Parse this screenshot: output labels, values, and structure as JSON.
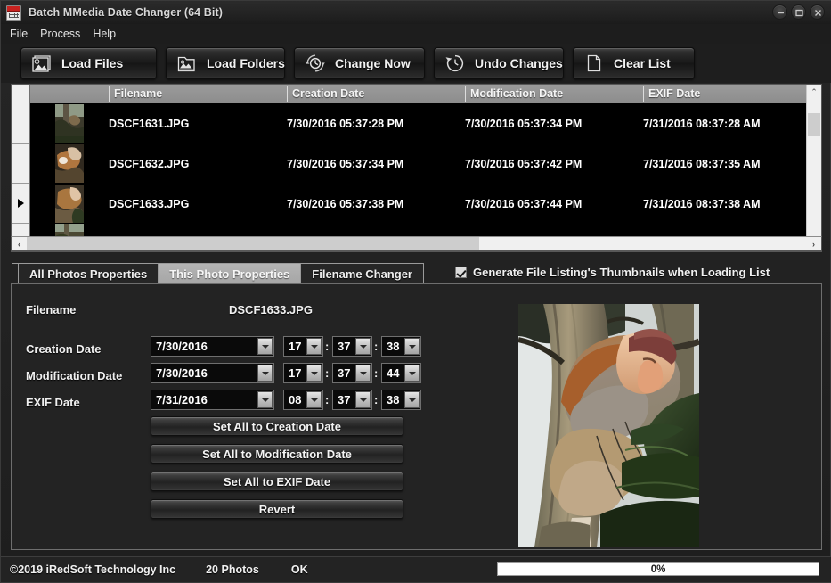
{
  "window": {
    "title": "Batch MMedia Date Changer (64 Bit)",
    "icon": "calendar-icon",
    "controls": [
      {
        "name": "minimize-button",
        "glyph": "minimize-icon"
      },
      {
        "name": "maximize-button",
        "glyph": "maximize-icon"
      },
      {
        "name": "close-button",
        "glyph": "close-icon"
      }
    ]
  },
  "menubar": {
    "items": [
      {
        "label": "File"
      },
      {
        "label": "Process"
      },
      {
        "label": "Help"
      }
    ]
  },
  "toolbar": {
    "buttons": [
      {
        "label": "Load Files",
        "icon": "picture-gear-icon"
      },
      {
        "label": "Load Folders",
        "icon": "folder-picture-icon"
      },
      {
        "label": "Change Now",
        "icon": "clock-refresh-icon"
      },
      {
        "label": "Undo Changes",
        "icon": "clock-undo-icon"
      },
      {
        "label": "Clear List",
        "icon": "page-icon"
      }
    ]
  },
  "filelist": {
    "columns": [
      "",
      "Filename",
      "Creation Date",
      "Modification Date",
      "EXIF Date"
    ],
    "rows": [
      {
        "filename": "DSCF1631.JPG",
        "creation": "7/30/2016 05:37:28 PM",
        "modification": "7/30/2016 05:37:34 PM",
        "exif": "7/31/2016 08:37:28 AM",
        "selected": false
      },
      {
        "filename": "DSCF1632.JPG",
        "creation": "7/30/2016 05:37:34 PM",
        "modification": "7/30/2016 05:37:42 PM",
        "exif": "7/31/2016 08:37:35 AM",
        "selected": false
      },
      {
        "filename": "DSCF1633.JPG",
        "creation": "7/30/2016 05:37:38 PM",
        "modification": "7/30/2016 05:37:44 PM",
        "exif": "7/31/2016 08:37:38 AM",
        "selected": true
      }
    ],
    "scroll": {
      "up_glyph": "⌃",
      "down_glyph": "⌄",
      "left_glyph": "‹",
      "right_glyph": "›"
    }
  },
  "tabs": [
    {
      "label": "All Photos Properties",
      "active": false
    },
    {
      "label": "This Photo Properties",
      "active": true
    },
    {
      "label": "Filename Changer",
      "active": false
    }
  ],
  "thumbnails_option": {
    "label": "Generate File Listing's Thumbnails when Loading List",
    "checked": true
  },
  "properties": {
    "filename_label": "Filename",
    "filename_value": "DSCF1633.JPG",
    "rows": [
      {
        "label": "Creation Date",
        "date": "7/30/2016",
        "hour": "17",
        "minute": "37",
        "second": "38"
      },
      {
        "label": "Modification Date",
        "date": "7/30/2016",
        "hour": "17",
        "minute": "37",
        "second": "44"
      },
      {
        "label": "EXIF Date",
        "date": "7/31/2016",
        "hour": "08",
        "minute": "37",
        "second": "38"
      }
    ],
    "separator": ":",
    "actions": [
      {
        "label": "Set All to Creation Date"
      },
      {
        "label": "Set All to Modification Date"
      },
      {
        "label": "Set All to EXIF Date"
      },
      {
        "label": "Revert"
      }
    ],
    "preview_alt": "proboscis-monkey-photo"
  },
  "statusbar": {
    "copyright": "©2019 iRedSoft Technology Inc",
    "count": "20 Photos",
    "state": "OK",
    "progress_text": "0%",
    "progress_percent": 0
  },
  "colors": {
    "window_bg": "#212121",
    "panel_bg": "#232323",
    "list_bg": "#000000",
    "header_gray": "#93939 3",
    "accent_text": "#ffffff",
    "tab_active": "#b4b4b4"
  }
}
